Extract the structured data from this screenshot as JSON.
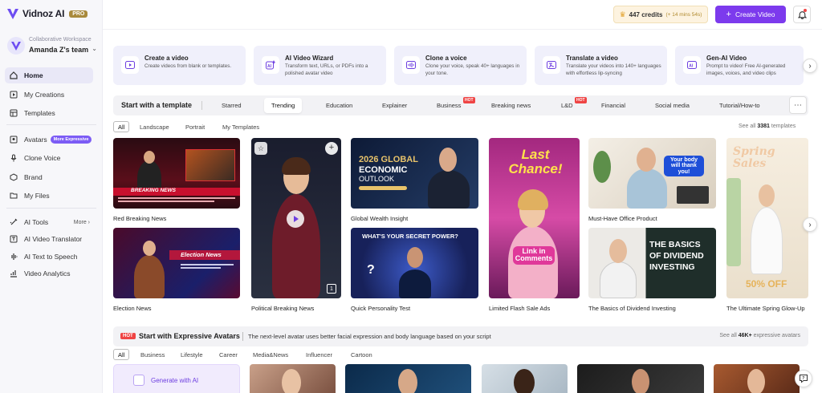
{
  "brand": {
    "name": "Vidnoz AI",
    "plan": "PRO"
  },
  "workspace": {
    "label": "Collaborative Workspace",
    "name": "Amanda Z's team"
  },
  "sidebar": {
    "items": [
      {
        "label": "Home",
        "icon": "home-icon"
      },
      {
        "label": "My Creations",
        "icon": "play-square-icon"
      },
      {
        "label": "Templates",
        "icon": "template-icon"
      },
      {
        "label": "Avatars",
        "icon": "avatar-icon",
        "badge": "More Expressive"
      },
      {
        "label": "Clone Voice",
        "icon": "voice-icon"
      },
      {
        "label": "Brand",
        "icon": "brand-icon"
      },
      {
        "label": "My Files",
        "icon": "folder-icon"
      },
      {
        "label": "AI Tools",
        "icon": "ai-tools-icon",
        "more": "More"
      },
      {
        "label": "AI Video Translator",
        "icon": "translate-icon"
      },
      {
        "label": "AI Text to Speech",
        "icon": "waveform-icon"
      },
      {
        "label": "Video Analytics",
        "icon": "analytics-icon"
      }
    ]
  },
  "topbar": {
    "credits": "447 credits",
    "credits_timer": "(+ 14 mins 54s)",
    "create_label": "Create Video"
  },
  "quick_actions": [
    {
      "title": "Create a video",
      "desc": "Create videos from blank or templates."
    },
    {
      "title": "AI Video Wizard",
      "desc": "Transform text, URLs, or PDFs into a polished avatar video"
    },
    {
      "title": "Clone a voice",
      "desc": "Clone your voice, speak 40+ languages in your tone."
    },
    {
      "title": "Translate a video",
      "desc": "Translate your videos into 140+ languages with effortless lip-syncing"
    },
    {
      "title": "Gen-AI Video",
      "desc": "Prompt to video! Free AI-generated images, voices, and video clips"
    }
  ],
  "templates": {
    "title": "Start with a template",
    "tabs": [
      "Starred",
      "Trending",
      "Education",
      "Explainer",
      "Business",
      "Breaking news",
      "L&D",
      "Financial",
      "Social media",
      "Tutorial/How-to"
    ],
    "hot_label": "HOT",
    "filters": [
      "All",
      "Landscape",
      "Portrait",
      "My Templates"
    ],
    "see_all": "See all",
    "count": "3381",
    "count_suffix": "templates",
    "items": [
      {
        "caption": "Red Breaking News"
      },
      {
        "caption": "Election News"
      },
      {
        "caption": "Political Breaking News"
      },
      {
        "caption": "Global Wealth Insight"
      },
      {
        "caption": "Quick Personality Test"
      },
      {
        "caption": "Limited Flash Sale Ads"
      },
      {
        "caption": "Must-Have Office Product"
      },
      {
        "caption": "The Basics of Dividend Investing"
      },
      {
        "caption": "The Ultimate Spring Glow-Up"
      }
    ],
    "thumb_text": {
      "breaking": "BREAKING NEWS",
      "election": "Election News",
      "wealth1": "2026 GLOBAL",
      "wealth2": "ECONOMIC",
      "wealth3": "OUTLOOK",
      "secret": "WHAT'S YOUR SECRET POWER?",
      "last": "Last Chance!",
      "link": "Link in Comments",
      "bubble": "Your body will thank you!",
      "div1": "THE BASICS",
      "div2": "OF DIVIDEND",
      "div3": "INVESTING",
      "spring": "Spring Sales",
      "off": "50% OFF",
      "counter": "1"
    }
  },
  "avatars": {
    "hot_label": "HOT",
    "title": "Start with Expressive Avatars",
    "desc": "The next-level avatar uses better facial expression and body language based on your script",
    "see_all": "See all",
    "count": "46K+",
    "count_suffix": "expressive avatars",
    "filters": [
      "All",
      "Business",
      "Lifestyle",
      "Career",
      "Media&News",
      "Influencer",
      "Cartoon"
    ],
    "generate_label": "Generate with AI"
  },
  "colors": {
    "accent": "#7c3aed",
    "hot": "#ef4444",
    "card_bg": "#f0f0fb"
  }
}
